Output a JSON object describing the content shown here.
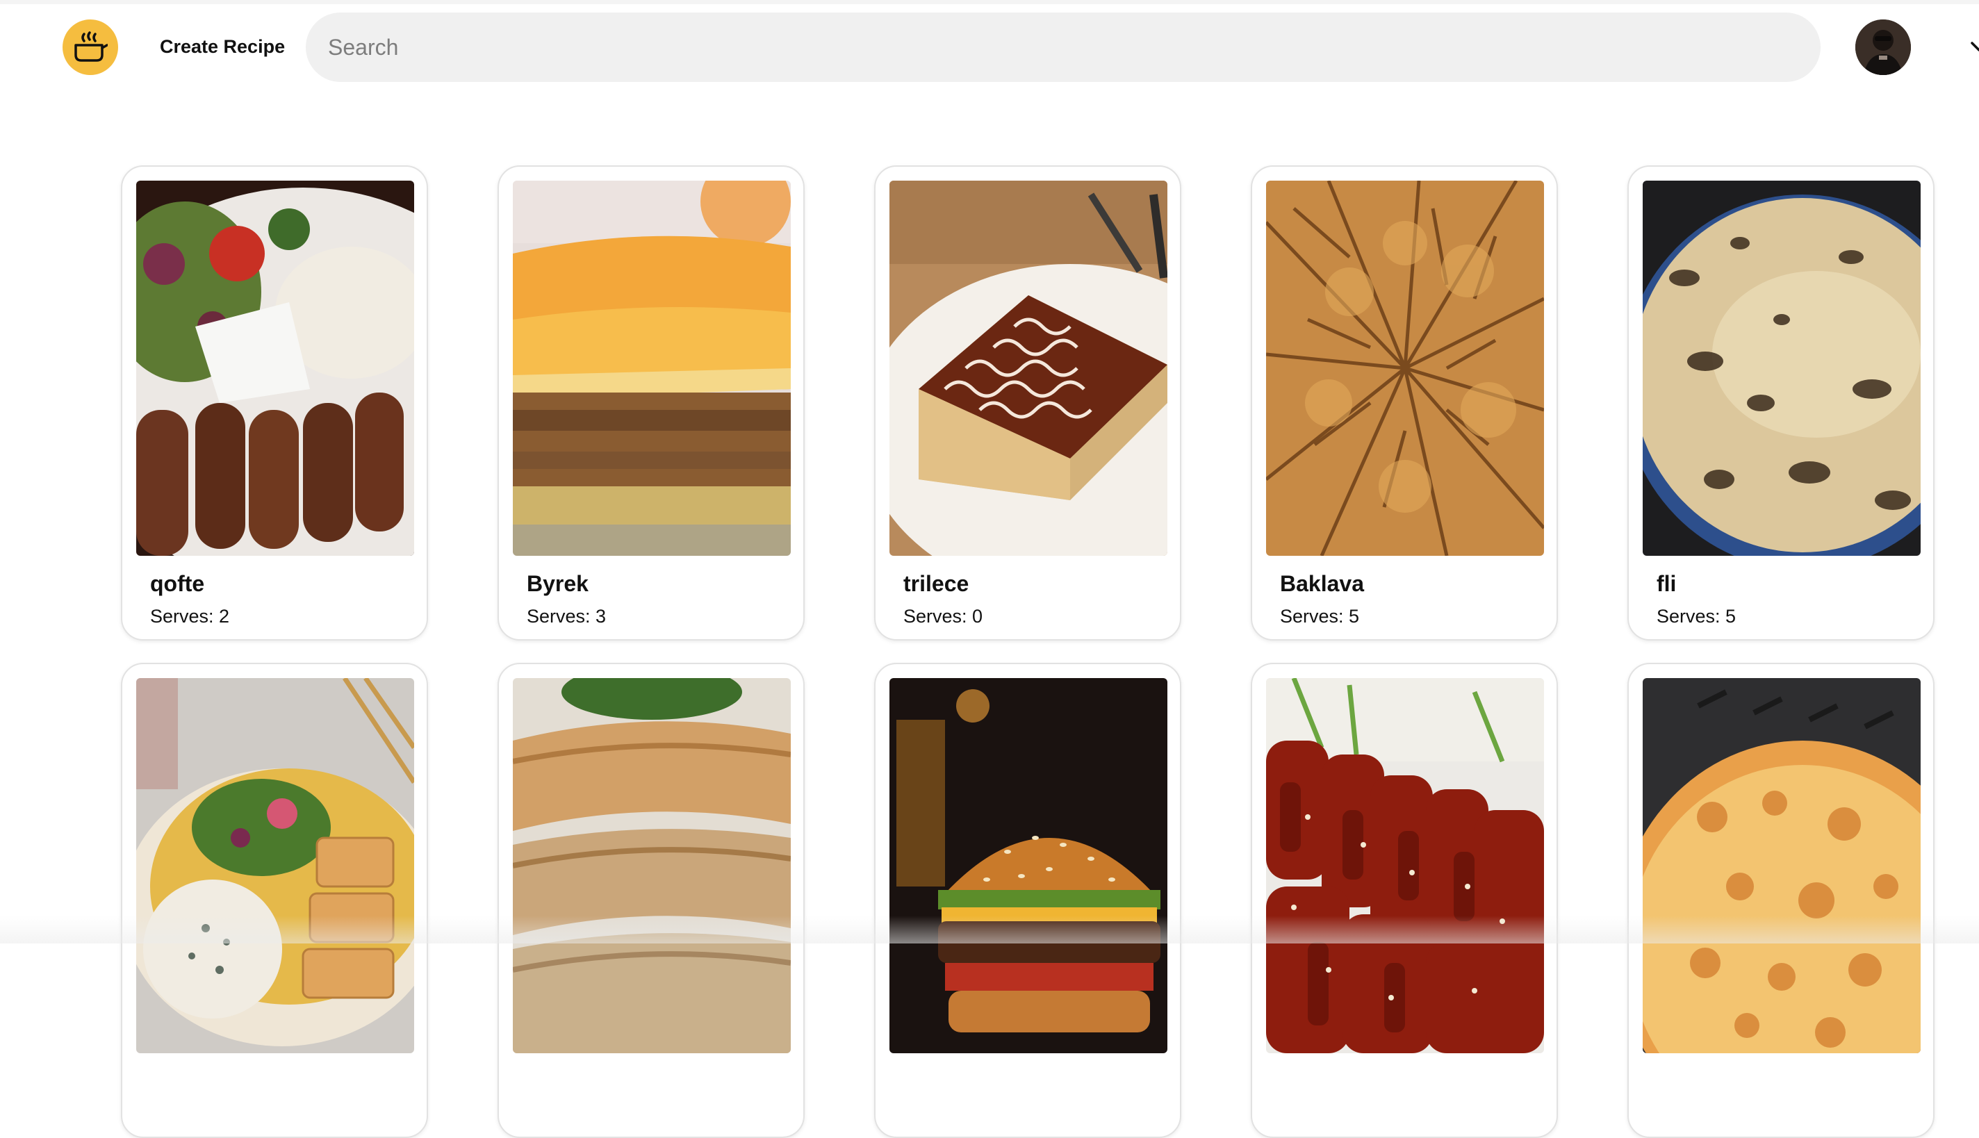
{
  "header": {
    "create_label": "Create Recipe",
    "search_placeholder": "Search"
  },
  "colors": {
    "logo_bg": "#f5bd3f",
    "search_bg": "#f0f0f0"
  },
  "recipes": [
    {
      "title": "qofte",
      "serves": "Serves: 2"
    },
    {
      "title": "Byrek",
      "serves": "Serves: 3"
    },
    {
      "title": "trilece",
      "serves": "Serves: 0"
    },
    {
      "title": "Baklava",
      "serves": "Serves: 5"
    },
    {
      "title": "fli",
      "serves": "Serves: 5"
    },
    {
      "title": "",
      "serves": ""
    },
    {
      "title": "",
      "serves": ""
    },
    {
      "title": "",
      "serves": ""
    },
    {
      "title": "",
      "serves": ""
    },
    {
      "title": "",
      "serves": ""
    }
  ]
}
